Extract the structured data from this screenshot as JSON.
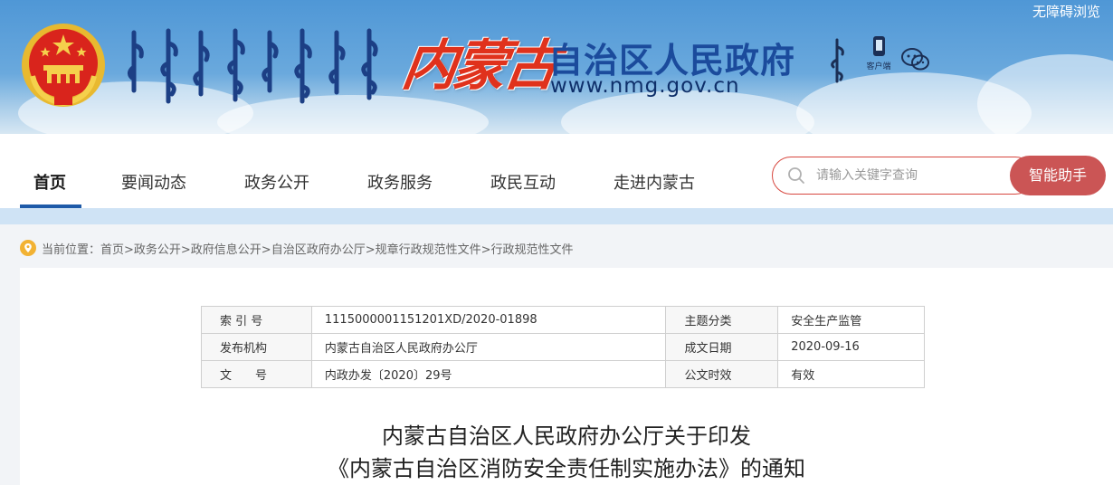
{
  "header": {
    "accessibility": "无障碍浏览",
    "site_name_calligraphy": "内蒙古",
    "site_name": "自治区人民政府",
    "url": "www.nmg.gov.cn",
    "client_label": "客户端"
  },
  "nav": {
    "items": [
      "首页",
      "要闻动态",
      "政务公开",
      "政务服务",
      "政民互动",
      "走进内蒙古"
    ],
    "active": "首页"
  },
  "search": {
    "placeholder": "请输入关键字查询",
    "assistant_label": "智能助手"
  },
  "breadcrumb": {
    "prefix": "当前位置：",
    "path": "首页>政务公开>政府信息公开>自治区政府办公厅>规章行政规范性文件>行政规范性文件"
  },
  "meta": {
    "rows": [
      {
        "label1": "索 引 号",
        "value1": "1115000001151201XD/2020-01898",
        "label2": "主题分类",
        "value2": "安全生产监管"
      },
      {
        "label1": "发布机构",
        "value1": "内蒙古自治区人民政府办公厅",
        "label2": "成文日期",
        "value2": "2020-09-16"
      },
      {
        "label1": "文　　号",
        "value1": "内政办发〔2020〕29号",
        "label2": "公文时效",
        "value2": "有效"
      }
    ]
  },
  "document": {
    "title_line1": "内蒙古自治区人民政府办公厅关于印发",
    "title_line2": "《内蒙古自治区消防安全责任制实施办法》的通知"
  },
  "colors": {
    "accent_red": "#cb5555",
    "nav_active": "#1e5aa8",
    "title_blue": "#1b4b9c"
  }
}
